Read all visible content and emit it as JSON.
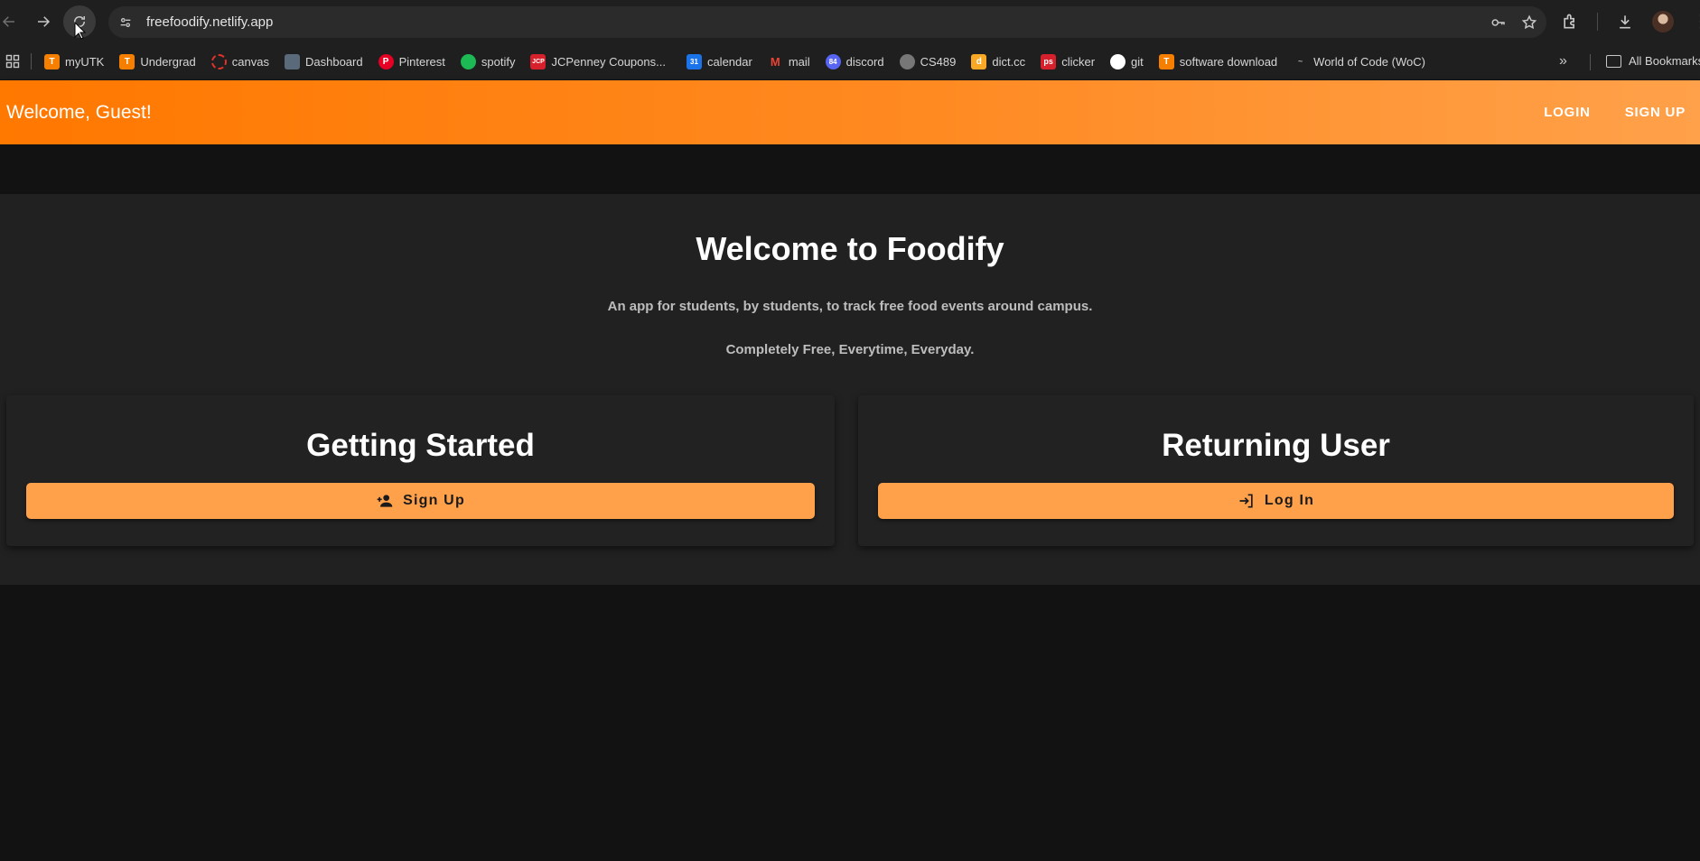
{
  "browser": {
    "url": "freefoodify.netlify.app",
    "bookmarks": [
      {
        "label": "myUTK",
        "icon": "ut-icon"
      },
      {
        "label": "Undergrad",
        "icon": "ut-icon"
      },
      {
        "label": "canvas",
        "icon": "canvas-icon"
      },
      {
        "label": "Dashboard",
        "icon": "dashboard-icon"
      },
      {
        "label": "Pinterest",
        "icon": "pinterest-icon"
      },
      {
        "label": "spotify",
        "icon": "spotify-icon"
      },
      {
        "label": "JCPenney Coupons...",
        "icon": "jcpenney-icon"
      },
      {
        "label": "calendar",
        "icon": "calendar-icon"
      },
      {
        "label": "mail",
        "icon": "gmail-icon"
      },
      {
        "label": "discord",
        "icon": "discord-icon"
      },
      {
        "label": "CS489",
        "icon": "globe-icon"
      },
      {
        "label": "dict.cc",
        "icon": "dictcc-icon"
      },
      {
        "label": "clicker",
        "icon": "ps-icon"
      },
      {
        "label": "git",
        "icon": "github-icon"
      },
      {
        "label": "software download",
        "icon": "ut-icon"
      },
      {
        "label": "World of Code (WoC)",
        "icon": "woc-icon"
      }
    ],
    "fav_text": {
      "ut": "T",
      "jcp": "JCP",
      "cal": "31",
      "mail": "M",
      "disc": "84",
      "dict": "d",
      "ps": "ps"
    },
    "all_bookmarks": "All Bookmarks"
  },
  "app": {
    "header": {
      "welcome": "Welcome, Guest!",
      "login": "LOGIN",
      "signup": "SIGN UP"
    },
    "hero": {
      "title": "Welcome to Foodify",
      "subtitle": "An app for students, by students, to track free food events around campus.",
      "tagline": "Completely Free, Everytime, Everyday."
    },
    "cards": {
      "left": {
        "title": "Getting Started",
        "button": "Sign Up",
        "icon": "person-add-icon"
      },
      "right": {
        "title": "Returning User",
        "button": "Log In",
        "icon": "login-icon"
      }
    }
  },
  "colors": {
    "accent": "#ff7800",
    "button": "#ffa04a",
    "background": "#121212",
    "panel": "#212121"
  }
}
